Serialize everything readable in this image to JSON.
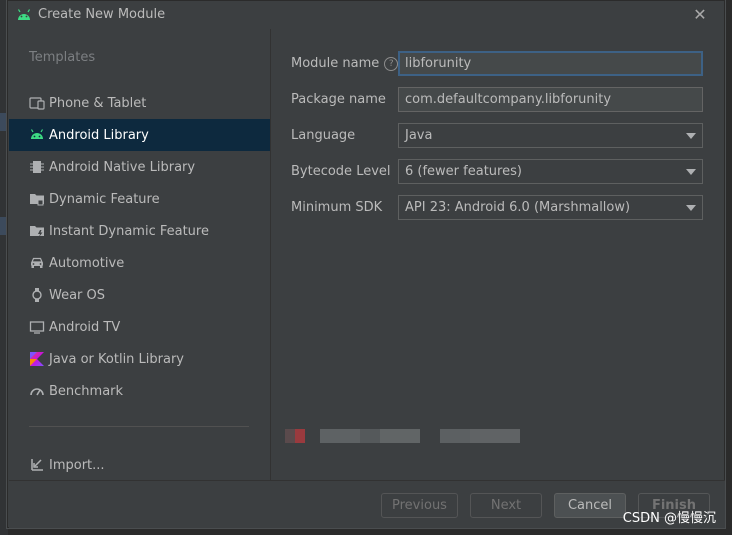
{
  "dialog": {
    "title": "Create New Module",
    "close_glyph": "✕"
  },
  "left_panel": {
    "section_title": "Templates",
    "templates": [
      {
        "label": "Phone & Tablet",
        "icon": "phone-tablet-icon",
        "selected": false
      },
      {
        "label": "Android Library",
        "icon": "android-icon",
        "selected": true
      },
      {
        "label": "Android Native Library",
        "icon": "native-library-icon",
        "selected": false
      },
      {
        "label": "Dynamic Feature",
        "icon": "folder-icon",
        "selected": false
      },
      {
        "label": "Instant Dynamic Feature",
        "icon": "folder-bolt-icon",
        "selected": false
      },
      {
        "label": "Automotive",
        "icon": "car-icon",
        "selected": false
      },
      {
        "label": "Wear OS",
        "icon": "watch-icon",
        "selected": false
      },
      {
        "label": "Android TV",
        "icon": "tv-icon",
        "selected": false
      },
      {
        "label": "Java or Kotlin Library",
        "icon": "kotlin-icon",
        "selected": false
      },
      {
        "label": "Benchmark",
        "icon": "gauge-icon",
        "selected": false
      }
    ],
    "import_label": "Import..."
  },
  "form": {
    "module_name": {
      "label": "Module name",
      "value": "libforunity"
    },
    "package_name": {
      "label": "Package name",
      "value": "com.defaultcompany.libforunity"
    },
    "language": {
      "label": "Language",
      "value": "Java"
    },
    "bytecode_level": {
      "label": "Bytecode Level",
      "value": "6 (fewer features)"
    },
    "minimum_sdk": {
      "label": "Minimum SDK",
      "value": "API 23: Android 6.0 (Marshmallow)"
    }
  },
  "footer": {
    "previous_label": "Previous",
    "next_label": "Next",
    "cancel_label": "Cancel",
    "finish_label": "Finish"
  },
  "watermark": "CSDN @慢慢沉",
  "colors": {
    "selection": "#0d293e",
    "android_green": "#3ddc84",
    "focus_border": "#3d6185",
    "dialog_bg": "#3c3f41"
  }
}
